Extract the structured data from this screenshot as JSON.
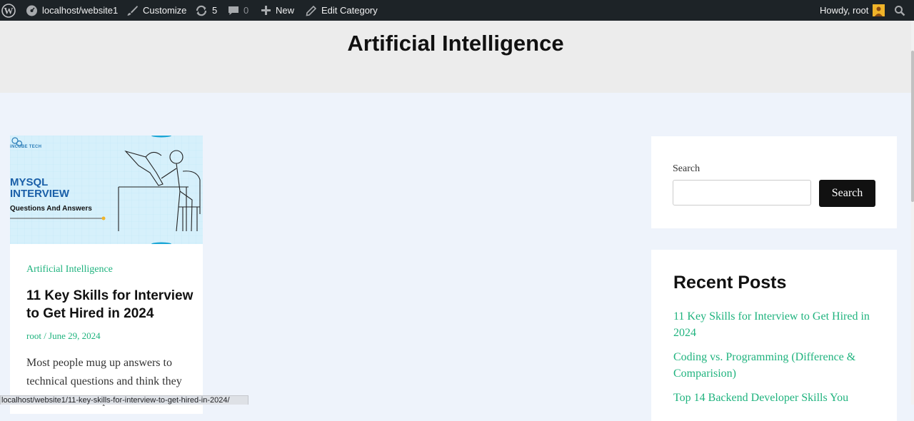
{
  "admin_bar": {
    "site_name": "localhost/website1",
    "customize": "Customize",
    "updates_count": "5",
    "comments_count": "0",
    "new_label": "New",
    "edit_category": "Edit Category",
    "howdy": "Howdy, root"
  },
  "header": {
    "title": "Artificial Intelligence"
  },
  "post": {
    "category": "Artificial Intelligence",
    "title": "11 Key Skills for Interview to Get Hired in 2024",
    "meta": "root / June 29, 2024",
    "excerpt": "Most people mug up answers to technical questions and think they know what to expect",
    "thumbnail": {
      "brand": "iNCUBE TECH",
      "heading_line1": "MYSQL",
      "heading_line2": "INTERVIEW",
      "subheading": "Questions And Answers"
    }
  },
  "search_widget": {
    "label": "Search",
    "input_value": "",
    "button": "Search"
  },
  "recent_posts": {
    "title": "Recent Posts",
    "items": [
      "11 Key Skills for Interview to Get Hired in 2024",
      "Coding vs. Programming (Difference & Comparision)",
      "Top 14 Backend Developer Skills You"
    ]
  },
  "status_bar": {
    "url": "localhost/website1/11-key-skills-for-interview-to-get-hired-in-2024/"
  },
  "colors": {
    "accent": "#1fb37e",
    "admin_bar": "#1d2327",
    "header_bg": "#ececec",
    "page_bg": "#eef3fb"
  }
}
